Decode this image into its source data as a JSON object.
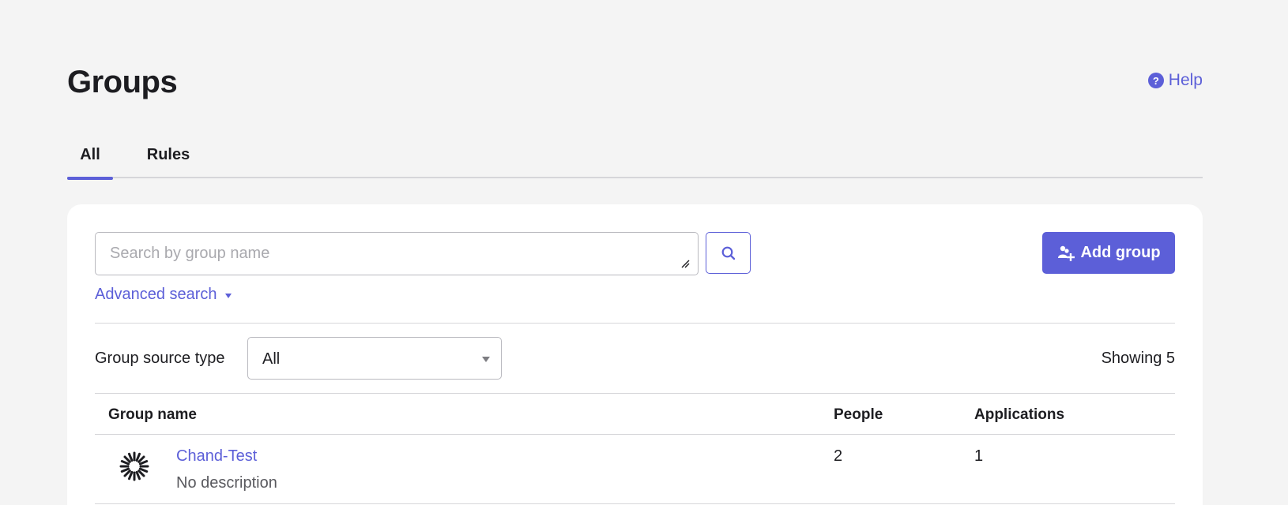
{
  "header": {
    "title": "Groups",
    "help_label": "Help"
  },
  "tabs": [
    {
      "label": "All",
      "active": true
    },
    {
      "label": "Rules",
      "active": false
    }
  ],
  "search": {
    "placeholder": "Search by group name",
    "value": "",
    "advanced_label": "Advanced search"
  },
  "actions": {
    "add_group_label": "Add group"
  },
  "filter": {
    "label": "Group source type",
    "selected": "All",
    "showing_text": "Showing 5"
  },
  "table": {
    "columns": [
      "Group name",
      "People",
      "Applications"
    ],
    "rows": [
      {
        "name": "Chand-Test",
        "description": "No description",
        "people": "2",
        "applications": "1",
        "icon": "okta-sunburst-icon"
      }
    ]
  },
  "colors": {
    "accent": "#5c5fd8",
    "background": "#f4f4f4",
    "card": "#ffffff"
  }
}
